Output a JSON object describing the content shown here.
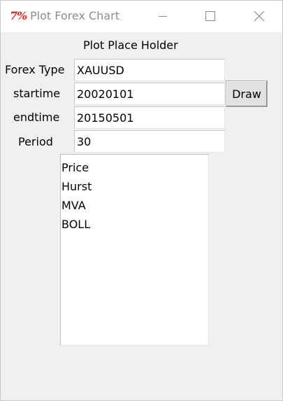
{
  "window": {
    "title": "Plot Forex Chart",
    "icon": "tk-feather-icon"
  },
  "plot": {
    "placeholder": "Plot Place Holder"
  },
  "form": {
    "forex_type_label": "Forex Type",
    "forex_type_value": "XAUUSD",
    "starttime_label": "startime",
    "starttime_value": "20020101",
    "endtime_label": "endtime",
    "endtime_value": "20150501",
    "period_label": "Period",
    "period_value": "30",
    "draw_label": "Draw"
  },
  "indicators": {
    "items": [
      "Price",
      "Hurst",
      "MVA",
      "BOLL"
    ]
  },
  "colors": {
    "window_bg": "#f0f0f0",
    "titlebar_bg": "#ffffff",
    "title_text": "#8e8e8e",
    "app_icon": "#e0261c"
  }
}
